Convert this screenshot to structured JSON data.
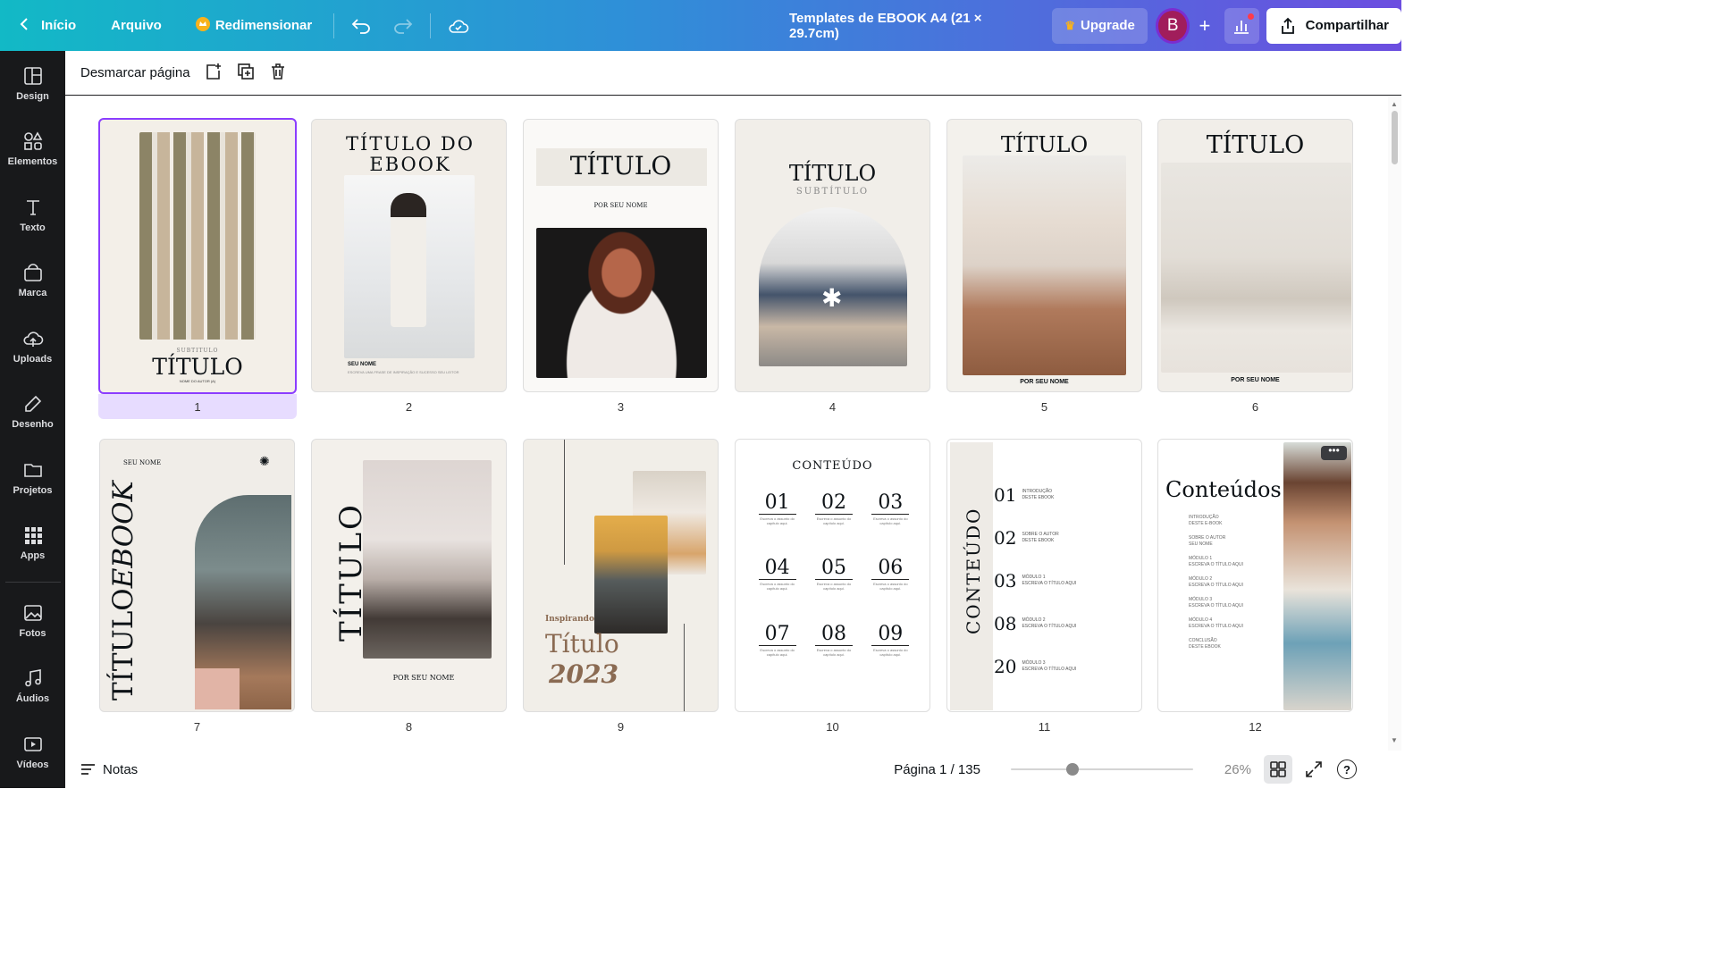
{
  "topbar": {
    "back_label": "Início",
    "file_label": "Arquivo",
    "resize_label": "Redimensionar",
    "doc_title": "Templates de EBOOK A4 (21 × 29.7cm)",
    "upgrade_label": "Upgrade",
    "avatar_letter": "B",
    "share_label": "Compartilhar"
  },
  "sidebar": {
    "items": [
      {
        "label": "Design"
      },
      {
        "label": "Elementos"
      },
      {
        "label": "Texto"
      },
      {
        "label": "Marca"
      },
      {
        "label": "Uploads"
      },
      {
        "label": "Desenho"
      },
      {
        "label": "Projetos"
      },
      {
        "label": "Apps"
      },
      {
        "label": "Fotos"
      },
      {
        "label": "Áudios"
      },
      {
        "label": "Vídeos"
      }
    ]
  },
  "toolbar": {
    "deselect_label": "Desmarcar página"
  },
  "pages": [
    {
      "num": "1",
      "title": "TÍTULO",
      "subtitle": "SUBTITULO",
      "author": "NOME DO AUTOR (A)"
    },
    {
      "num": "2",
      "title": "TÍTULO DO EBOOK",
      "name": "SEU NOME",
      "tagline": "ESCREVA UMA FRASE DE INSPIRAÇÃO E SUCESSO SEU LEITOR"
    },
    {
      "num": "3",
      "title": "TÍTULO",
      "byline": "POR SEU NOME"
    },
    {
      "num": "4",
      "title": "TÍTULO",
      "subtitle": "SUBTÍTULO"
    },
    {
      "num": "5",
      "title": "TÍTULO",
      "byline": "POR SEU NOME"
    },
    {
      "num": "6",
      "title": "TÍTULO",
      "byline": "POR SEU NOME"
    },
    {
      "num": "7",
      "name": "SEU NOME",
      "title_a": "TÍTULO",
      "title_b": "EBOOK"
    },
    {
      "num": "8",
      "title": "TÍTULO",
      "byline": "POR SEU NOME"
    },
    {
      "num": "9",
      "kicker": "Inspirando",
      "title": "Título",
      "year": "2023"
    },
    {
      "num": "10",
      "title": "CONTEÚDO",
      "chapters": [
        "01",
        "02",
        "03",
        "04",
        "05",
        "06",
        "07",
        "08",
        "09"
      ],
      "chapter_desc": "Escreva o assunto do capítulo aqui."
    },
    {
      "num": "11",
      "title": "CONTEÚDO",
      "items": [
        {
          "n": "01",
          "t1": "INTRODUÇÃO",
          "t2": "DESTE EBOOK"
        },
        {
          "n": "02",
          "t1": "SOBRE O AUTOR",
          "t2": "DESTE EBOOK"
        },
        {
          "n": "03",
          "t1": "MÓDULO 1",
          "t2": "ESCREVA O TÍTULO AQUI"
        },
        {
          "n": "08",
          "t1": "MÓDULO 2",
          "t2": "ESCREVA O TÍTULO AQUI"
        },
        {
          "n": "20",
          "t1": "MÓDULO 3",
          "t2": "ESCREVA O TÍTULO AQUI"
        }
      ]
    },
    {
      "num": "12",
      "title": "Conteúdos",
      "items": [
        {
          "t1": "INTRODUÇÃO",
          "t2": "DESTE E-BOOK"
        },
        {
          "t1": "SOBRE O AUTOR",
          "t2": "SEU NOME"
        },
        {
          "t1": "MÓDULO 1",
          "t2": "ESCREVA O TÍTULO AQUI"
        },
        {
          "t1": "MÓDULO 2",
          "t2": "ESCREVA O TÍTULO AQUI"
        },
        {
          "t1": "MÓDULO 3",
          "t2": "ESCREVA O TÍTULO AQUI"
        },
        {
          "t1": "MÓDULO 4",
          "t2": "ESCREVA O TÍTULO AQUI"
        },
        {
          "t1": "CONCLUSÃO",
          "t2": "DESTE EBOOK"
        }
      ]
    }
  ],
  "statusbar": {
    "notes_label": "Notas",
    "page_indicator": "Página 1 / 135",
    "zoom": "26%",
    "zoom_fraction": 0.26
  }
}
